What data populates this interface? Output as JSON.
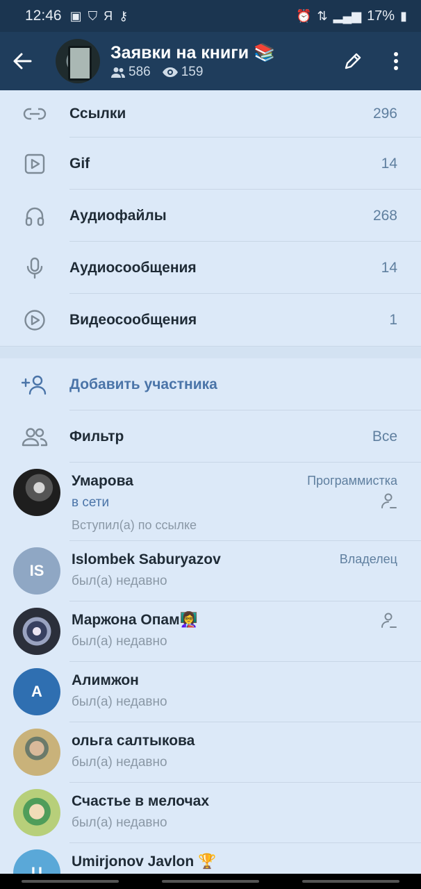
{
  "status_bar": {
    "time": "12:46",
    "carrier_glyph": "Я",
    "battery": "17%"
  },
  "header": {
    "title": "Заявки на книги",
    "title_emoji": "📚",
    "members": "586",
    "views": "159"
  },
  "media": [
    {
      "icon": "link-icon",
      "label": "Ссылки",
      "count": "296"
    },
    {
      "icon": "gif-icon",
      "label": "Gif",
      "count": "14"
    },
    {
      "icon": "headphones-icon",
      "label": "Аудиофайлы",
      "count": "268"
    },
    {
      "icon": "microphone-icon",
      "label": "Аудиосообщения",
      "count": "14"
    },
    {
      "icon": "video-message-icon",
      "label": "Видеосообщения",
      "count": "1"
    }
  ],
  "add_member": {
    "label": "Добавить участника"
  },
  "filter": {
    "label": "Фильтр",
    "value": "Все"
  },
  "members": [
    {
      "name": "Умарова",
      "status": "в сети",
      "note": "Вступил(а) по ссылке",
      "role": "Программистка",
      "avatar_color": "#3a3a3a"
    },
    {
      "name": "Islombek Saburyazov",
      "status": "был(а) недавно",
      "role": "Владелец",
      "initials": "IS",
      "avatar_color": "#8fa7c4"
    },
    {
      "name": "Маржона Опам",
      "name_emoji": "👩‍🏫",
      "status": "был(а) недавно",
      "avatar_color": "#6d6d7d"
    },
    {
      "name": "Алимжон",
      "status": "был(а) недавно",
      "initials": "A",
      "avatar_color": "#2f6fb1"
    },
    {
      "name": "ольга салтыкова",
      "status": "был(а) недавно",
      "avatar_color": "#b8a06e"
    },
    {
      "name": "Счастье в мелочах",
      "status": "был(а) недавно",
      "avatar_color": "#7fb06a"
    },
    {
      "name": "Umirjonov Javlon",
      "name_emoji": "🏆",
      "initials": "U",
      "avatar_color": "#5aa8d8"
    }
  ]
}
